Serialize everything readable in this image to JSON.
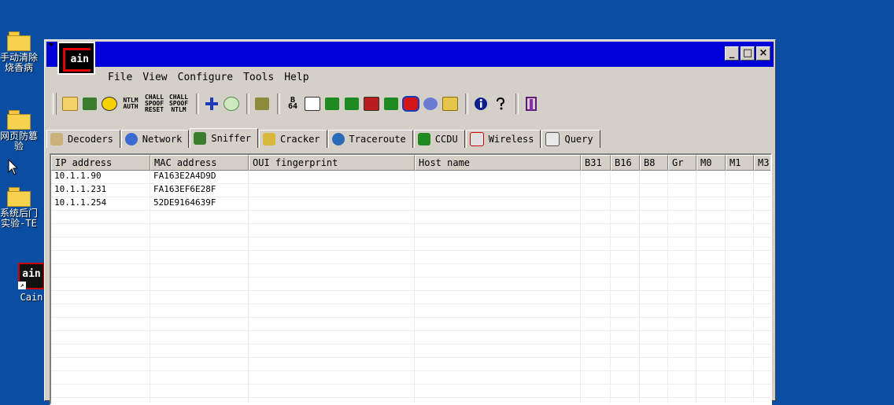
{
  "desktop": {
    "icons": [
      {
        "label_lines": [
          "手动清除",
          "烧香病"
        ],
        "icon": "folder-icon"
      },
      {
        "label_lines": [
          "网页防篡",
          "验"
        ],
        "icon": "folder-icon"
      },
      {
        "label_lines": [
          "系统后门",
          "实验-TE"
        ],
        "icon": "folder-icon"
      },
      {
        "label_lines": [
          "Cain"
        ],
        "icon": "cain-shortcut-icon"
      }
    ]
  },
  "window": {
    "logo_text": "ain",
    "controls": {
      "minimize": "_",
      "maximize": "□",
      "close": "×"
    }
  },
  "menu": {
    "items": [
      "File",
      "View",
      "Configure",
      "Tools",
      "Help"
    ]
  },
  "toolbar": {
    "buttons": [
      {
        "name": "open-icon"
      },
      {
        "name": "start-sniffer-icon"
      },
      {
        "name": "start-apr-icon"
      },
      {
        "name": "ntlm-auth-icon",
        "text": "NTLM AUTH"
      },
      {
        "name": "chall-spoof-reset-icon",
        "text": "CHALL SPOOF RESET"
      },
      {
        "name": "chall-spoof-ntlm-icon",
        "text": "CHALL SPOOF NTLM"
      },
      {
        "name": "add-icon"
      },
      {
        "name": "remove-icon"
      },
      {
        "name": "network-cards-icon"
      },
      {
        "name": "base64-icon",
        "text": "B 64"
      },
      {
        "name": "hash-calculator-icon"
      },
      {
        "name": "lsa-secrets-icon"
      },
      {
        "name": "vnc-icon"
      },
      {
        "name": "rdp-icon"
      },
      {
        "name": "cisco-icon"
      },
      {
        "name": "box-revealer-icon"
      },
      {
        "name": "wireless-icon"
      },
      {
        "name": "password-decoder-icon"
      },
      {
        "name": "about-icon"
      },
      {
        "name": "help-icon"
      },
      {
        "name": "exit-icon"
      }
    ]
  },
  "tabs": [
    {
      "label": "Decoders",
      "icon": "decoders-icon",
      "active": false
    },
    {
      "label": "Network",
      "icon": "network-icon",
      "active": false
    },
    {
      "label": "Sniffer",
      "icon": "sniffer-icon",
      "active": true
    },
    {
      "label": "Cracker",
      "icon": "cracker-icon",
      "active": false
    },
    {
      "label": "Traceroute",
      "icon": "traceroute-icon",
      "active": false
    },
    {
      "label": "CCDU",
      "icon": "ccdu-icon",
      "active": false
    },
    {
      "label": "Wireless",
      "icon": "wireless-tab-icon",
      "active": false
    },
    {
      "label": "Query",
      "icon": "query-icon",
      "active": false
    }
  ],
  "table": {
    "columns": [
      "IP address",
      "MAC address",
      "OUI fingerprint",
      "Host name",
      "B31",
      "B16",
      "B8",
      "Gr",
      "M0",
      "M1",
      "M3"
    ],
    "rows": [
      [
        "10.1.1.90",
        "FA163E2A4D9D",
        "",
        "",
        "",
        "",
        "",
        "",
        "",
        "",
        ""
      ],
      [
        "10.1.1.231",
        "FA163EF6E28F",
        "",
        "",
        "",
        "",
        "",
        "",
        "",
        "",
        ""
      ],
      [
        "10.1.1.254",
        "52DE9164639F",
        "",
        "",
        "",
        "",
        "",
        "",
        "",
        "",
        ""
      ]
    ]
  },
  "colors": {
    "desktop": "#0a4ea3",
    "titlebar": "#0000d8",
    "chrome": "#d4d0c8"
  }
}
